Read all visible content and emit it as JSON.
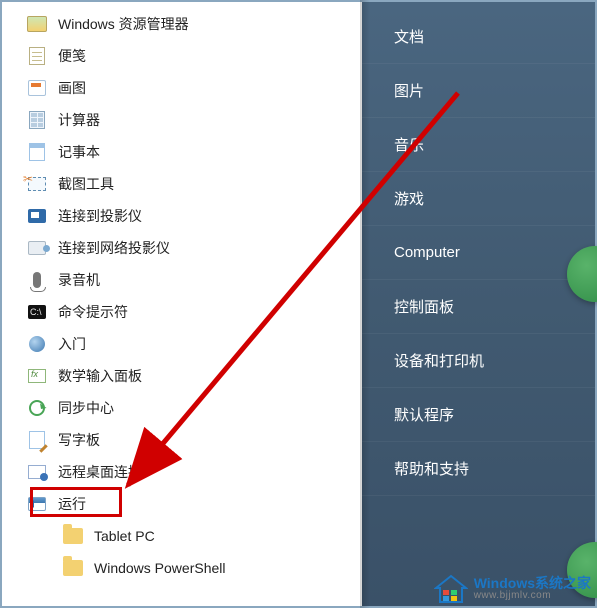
{
  "left_programs": [
    {
      "id": "explorer",
      "label": "Windows 资源管理器",
      "icon": "explorer-icon"
    },
    {
      "id": "sticky-notes",
      "label": "便笺",
      "icon": "sticky-notes-icon"
    },
    {
      "id": "paint",
      "label": "画图",
      "icon": "paint-icon"
    },
    {
      "id": "calculator",
      "label": "计算器",
      "icon": "calculator-icon"
    },
    {
      "id": "notepad",
      "label": "记事本",
      "icon": "notepad-icon"
    },
    {
      "id": "snipping-tool",
      "label": "截图工具",
      "icon": "scissors-icon"
    },
    {
      "id": "connect-projector",
      "label": "连接到投影仪",
      "icon": "projector-icon"
    },
    {
      "id": "network-projector",
      "label": "连接到网络投影仪",
      "icon": "network-projector-icon"
    },
    {
      "id": "sound-recorder",
      "label": "录音机",
      "icon": "microphone-icon"
    },
    {
      "id": "command-prompt",
      "label": "命令提示符",
      "icon": "cmd-icon"
    },
    {
      "id": "getting-started",
      "label": "入门",
      "icon": "start-orb-icon"
    },
    {
      "id": "math-input",
      "label": "数学输入面板",
      "icon": "math-input-icon"
    },
    {
      "id": "sync-center",
      "label": "同步中心",
      "icon": "sync-icon"
    },
    {
      "id": "wordpad",
      "label": "写字板",
      "icon": "wordpad-icon"
    },
    {
      "id": "remote-desktop",
      "label": "远程桌面连接",
      "icon": "remote-desktop-icon"
    },
    {
      "id": "run",
      "label": "运行",
      "icon": "run-icon",
      "highlighted": true
    },
    {
      "id": "tablet-pc-folder",
      "label": "Tablet PC",
      "icon": "folder-icon",
      "indent": true
    },
    {
      "id": "powershell-folder",
      "label": "Windows PowerShell",
      "icon": "folder-icon",
      "indent": true
    }
  ],
  "right_items": [
    {
      "id": "documents",
      "label": "文档"
    },
    {
      "id": "pictures",
      "label": "图片"
    },
    {
      "id": "music",
      "label": "音乐"
    },
    {
      "id": "games",
      "label": "游戏"
    },
    {
      "id": "computer",
      "label": "Computer"
    },
    {
      "id": "control-panel",
      "label": "控制面板"
    },
    {
      "id": "devices",
      "label": "设备和打印机"
    },
    {
      "id": "default-programs",
      "label": "默认程序"
    },
    {
      "id": "help",
      "label": "帮助和支持"
    }
  ],
  "annotation": {
    "arrow_from": "right-item-pictures",
    "arrow_to": "program-run",
    "highlight_target": "program-run"
  },
  "watermark": {
    "line1": "Windows系统之家",
    "line2": "www.bjjmlv.com"
  }
}
